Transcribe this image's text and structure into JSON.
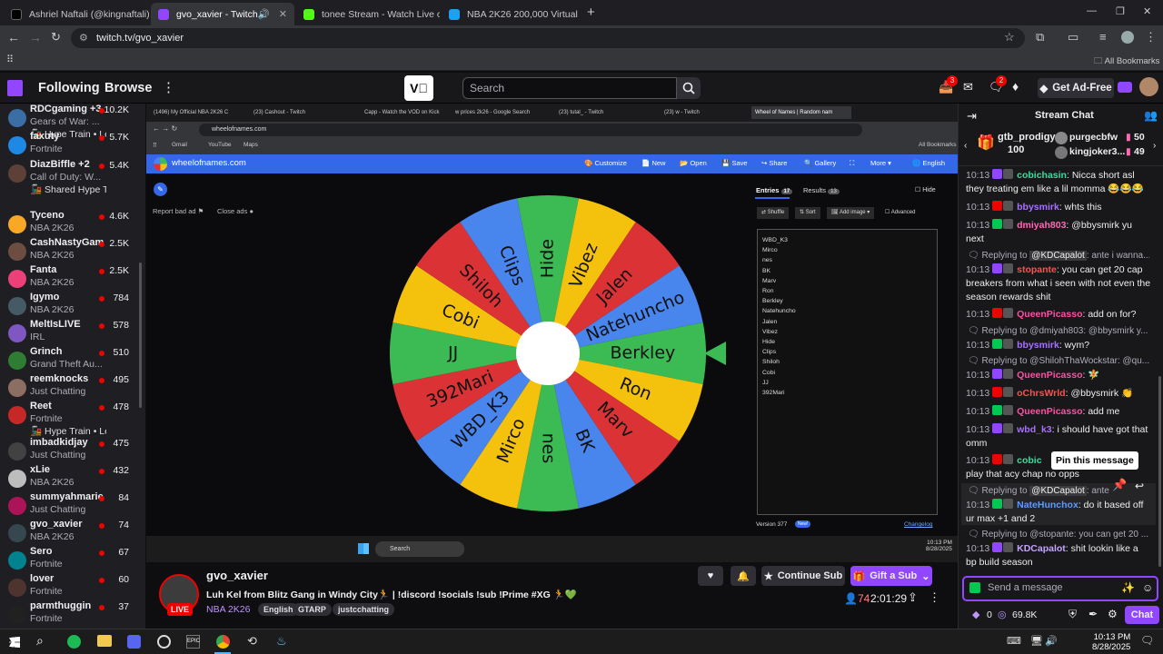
{
  "browser": {
    "tabs": [
      {
        "title": "Ashriel Naftali (@kingnaftali) | T",
        "color": "#000000"
      },
      {
        "title": "gvo_xavier - Twitch",
        "color": "#9147ff"
      },
      {
        "title": "tonee Stream - Watch Live on K",
        "color": "#53fc18"
      },
      {
        "title": "NBA 2K26 200,000 Virtual Curre",
        "color": "#1da1f2"
      }
    ],
    "url": "twitch.tv/gvo_xavier",
    "all_bookmarks": "All Bookmarks"
  },
  "twitch": {
    "following": "Following",
    "browse": "Browse",
    "search_placeholder": "Search",
    "notif_count": "3",
    "whisper_count": "2",
    "get_ad_free": "Get Ad-Free"
  },
  "sidebar": [
    {
      "name": "RDCgaming +3",
      "game": "Gears of War: ...",
      "viewers": "10.2K",
      "extra": "Hype Train • Level 5",
      "color": "#3a6ea5"
    },
    {
      "name": "faxuty",
      "game": "Fortnite",
      "viewers": "5.7K",
      "color": "#1e88e5"
    },
    {
      "name": "DiazBiffle +2",
      "game": "Call of Duty: W...",
      "viewers": "5.4K",
      "extra": "Shared Hype Train ...",
      "color": "#5d4037"
    },
    {
      "name": "Tyceno",
      "game": "NBA 2K26",
      "viewers": "4.6K",
      "color": "#f9a825"
    },
    {
      "name": "CashNastyGam...",
      "game": "NBA 2K26",
      "viewers": "2.5K",
      "color": "#6d4c41"
    },
    {
      "name": "Fanta",
      "game": "NBA 2K26",
      "viewers": "2.5K",
      "color": "#ec407a"
    },
    {
      "name": "Igymo",
      "game": "NBA 2K26",
      "viewers": "784",
      "color": "#455a64"
    },
    {
      "name": "MeltIsLIVE",
      "game": "IRL",
      "viewers": "578",
      "color": "#7e57c2"
    },
    {
      "name": "Grinch",
      "game": "Grand Theft Au...",
      "viewers": "510",
      "color": "#2e7d32"
    },
    {
      "name": "reemknocks",
      "game": "Just Chatting",
      "viewers": "495",
      "color": "#8d6e63"
    },
    {
      "name": "Reet",
      "game": "Fortnite",
      "viewers": "478",
      "extra": "Hype Train • Level 1",
      "color": "#c62828"
    },
    {
      "name": "imbadkidjay",
      "game": "Just Chatting",
      "viewers": "475",
      "color": "#424242"
    },
    {
      "name": "xLie",
      "game": "NBA 2K26",
      "viewers": "432",
      "color": "#bdbdbd"
    },
    {
      "name": "summyahmarie",
      "game": "Just Chatting",
      "viewers": "84",
      "color": "#ad1457"
    },
    {
      "name": "gvo_xavier",
      "game": "NBA 2K26",
      "viewers": "74",
      "color": "#37474f"
    },
    {
      "name": "Sero",
      "game": "Fortnite",
      "viewers": "67",
      "color": "#00838f"
    },
    {
      "name": "lover",
      "game": "Fortnite",
      "viewers": "60",
      "color": "#4e342e"
    },
    {
      "name": "parmthuggin",
      "game": "Fortnite",
      "viewers": "37",
      "color": "#212121"
    }
  ],
  "screen": {
    "tabs": [
      "(1496) My Official NBA 2K26 C",
      "(23) Cashout - Twitch",
      "Capp - Watch the VOD on Kick",
      "w prices 2k26 - Google Search",
      "(23) tutal_ - Twitch",
      "(23) w - Twitch",
      "Wheel of Names | Random nam"
    ],
    "url": "wheelofnames.com",
    "bookmarks": [
      "Gmail",
      "YouTube",
      "Maps"
    ],
    "all_bookmarks": "All Bookmarks",
    "wof_title": "wheelofnames.com",
    "menu": [
      "Customize",
      "New",
      "Open",
      "Save",
      "Share",
      "Gallery",
      "More",
      "English"
    ],
    "report_ad": "Report bad ad",
    "close_ads": "Close ads",
    "entries_tab": "Entries",
    "entries_count": "17",
    "results_tab": "Results",
    "results_count": "13",
    "hide": "Hide",
    "shuffle": "Shuffle",
    "sort": "Sort",
    "add_image": "Add image",
    "advanced": "Advanced",
    "entries": [
      "WBD_K3",
      "Mirco",
      "nes",
      "BK",
      "Marv",
      "Ron",
      "Berkley",
      "Natehuncho",
      "Jalen",
      "Vibez",
      "Hide",
      "Clips",
      "Shiloh",
      "Cobi",
      "JJ",
      "392Mari"
    ],
    "version": "Version 377",
    "new_badge": "New!",
    "changelog": "Changelog",
    "wheel": [
      {
        "label": "Hide",
        "color": "#3cba54"
      },
      {
        "label": "Vibez",
        "color": "#f4c20d"
      },
      {
        "label": "Jalen",
        "color": "#db3236"
      },
      {
        "label": "Natehuncho",
        "color": "#4885ed"
      },
      {
        "label": "Berkley",
        "color": "#3cba54"
      },
      {
        "label": "Ron",
        "color": "#f4c20d"
      },
      {
        "label": "Marv",
        "color": "#db3236"
      },
      {
        "label": "BK",
        "color": "#4885ed"
      },
      {
        "label": "nes",
        "color": "#3cba54"
      },
      {
        "label": "Mirco",
        "color": "#f4c20d"
      },
      {
        "label": "WBD_K3",
        "color": "#4885ed"
      },
      {
        "label": "392Mari",
        "color": "#db3236"
      },
      {
        "label": "JJ",
        "color": "#3cba54"
      },
      {
        "label": "Cobi",
        "color": "#f4c20d"
      },
      {
        "label": "Shiloh",
        "color": "#db3236"
      },
      {
        "label": "Clips",
        "color": "#4885ed"
      }
    ],
    "task_search": "Search",
    "time": "10:13 PM",
    "date": "8/28/2025"
  },
  "stream": {
    "channel": "gvo_xavier",
    "title": "Luh Kel from Blitz Gang in Windy City🏃 | !discord !socials !sub !Prime #XG 🏃💚",
    "category": "NBA 2K26",
    "tags": [
      "English",
      "GTARP",
      "justcchatting"
    ],
    "live": "LIVE",
    "continue_sub": "Continue Sub",
    "gift_sub": "Gift a Sub",
    "viewers": "74",
    "uptime": "2:01:29"
  },
  "chat": {
    "title": "Stream Chat",
    "top_gifter": "gtb_prodigy",
    "top_gifter_count": "100",
    "leaders": [
      {
        "name": "purgecbfw",
        "count": "50"
      },
      {
        "name": "kingjoker3...",
        "count": "49"
      }
    ],
    "messages": [
      {
        "time": "10:13",
        "user": "cobichasin",
        "color": "#2de29b",
        "text": ": Nicca short asl they treating em like a lil momma 😂😂😂"
      },
      {
        "time": "10:13",
        "user": "bbysmirk",
        "color": "#a970ff",
        "text": ": whts this"
      },
      {
        "time": "10:13",
        "user": "dmiyah803",
        "color": "#ff69b4",
        "text": ": @bbysmirk yu next"
      },
      {
        "reply": "Replying to",
        "reply_user": "@KDCapalot",
        "reply_text": ": ante i wanna...",
        "time": "10:13",
        "user": "stopante",
        "color": "#ff4f4f",
        "text": ": you can get 20 cap breakers from what i seen with not even the season rewards shit"
      },
      {
        "time": "10:13",
        "user": "QueenPicasso",
        "color": "#ff4fa3",
        "text": ": add on for?"
      },
      {
        "reply": "Replying to @dmiyah803: @bbysmirk y...",
        "time": "10:13",
        "user": "bbysmirk",
        "color": "#a970ff",
        "text": ": wym?"
      },
      {
        "reply": "Replying to @ShilohThaWockstar: @qu...",
        "time": "10:13",
        "user": "QueenPicasso",
        "color": "#ff4fa3",
        "text": ": 🧚"
      },
      {
        "time": "10:13",
        "user": "oChrsWrld",
        "color": "#ff4f4f",
        "text": ": @bbysmirk 👏"
      },
      {
        "time": "10:13",
        "user": "QueenPicasso",
        "color": "#ff4fa3",
        "text": ": add me"
      },
      {
        "time": "10:13",
        "user": "wbd_k3",
        "color": "#a970ff",
        "text": ": i should have got that omm"
      },
      {
        "time": "10:13",
        "user": "cobic",
        "color": "#2de29b",
        "text": "play that acy chap no opps"
      },
      {
        "reply": "Replying to",
        "reply_user": "@KDCapalot",
        "reply_text": ": ante",
        "time": "10:13",
        "user": "NateHunchox",
        "color": "#5b9cff",
        "text": ": do it based off ur max +1 and 2"
      },
      {
        "reply": "Replying to @stopante: you can get 20 ...",
        "time": "10:13",
        "user": "KDCapalot",
        "color": "#c5a3ff",
        "text": ": shit lookin like a bp build season"
      }
    ],
    "tooltip": "Pin this message",
    "input_placeholder": "Send a message",
    "points": "0",
    "points2": "69.8K",
    "chat_button": "Chat"
  },
  "taskbar": {
    "time": "10:13 PM",
    "date": "8/28/2025"
  }
}
